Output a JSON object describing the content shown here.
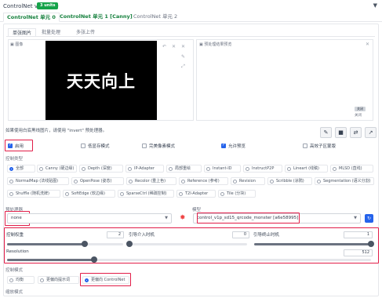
{
  "header": {
    "title": "ControlNet v1.1.449",
    "units_badge": "3 units"
  },
  "unit_tabs": [
    "ControlNet 单元 0",
    "ControlNet 单元 1 [Canny]",
    "ControlNet 单元 2"
  ],
  "image_tabs": [
    "单张图片",
    "批量处理",
    "多张上传"
  ],
  "image": {
    "label": "图像",
    "text": "天天向上"
  },
  "preview": {
    "label": "预处理结果预览",
    "close_btn": "关闭",
    "close_label": "关闭"
  },
  "hint": "如果使用白底黑线图片，请使用 \"invert\" 预处理器。",
  "options": {
    "enable": "启用",
    "low_vram": "低显存模式",
    "pixel_perfect": "完美像素模式",
    "allow_preview": "允许预览",
    "effective_region_mask": "高效子区蒙版"
  },
  "control_type": {
    "label": "控制类型",
    "items": [
      {
        "label": "全部",
        "selected": true
      },
      {
        "label": "Canny (硬边缘)",
        "selected": false
      },
      {
        "label": "Depth (深度)",
        "selected": false
      },
      {
        "label": "IP-Adapter",
        "selected": false
      },
      {
        "label": "局部重绘",
        "selected": false
      },
      {
        "label": "Instant-ID",
        "selected": false
      },
      {
        "label": "InstructP2P",
        "selected": false
      },
      {
        "label": "Lineart (线稿)",
        "selected": false
      },
      {
        "label": "MLSD (直线)",
        "selected": false
      },
      {
        "label": "NormalMap (法线贴图)",
        "selected": false
      },
      {
        "label": "OpenPose (姿态)",
        "selected": false
      },
      {
        "label": "Recolor (重上色)",
        "selected": false
      },
      {
        "label": "Reference (参考)",
        "selected": false
      },
      {
        "label": "Revision",
        "selected": false
      },
      {
        "label": "Scribble (涂鸦)",
        "selected": false
      },
      {
        "label": "Segmentation (语义分割)",
        "selected": false
      },
      {
        "label": "Shuffle (随机洗牌)",
        "selected": false
      },
      {
        "label": "SoftEdge (软边缘)",
        "selected": false
      },
      {
        "label": "SparseCtrl (稀疏控制)",
        "selected": false
      },
      {
        "label": "T2I-Adapter",
        "selected": false
      },
      {
        "label": "Tile (分块)",
        "selected": false
      }
    ]
  },
  "preprocessor": {
    "label": "预处理器",
    "value": "none"
  },
  "model": {
    "label": "模型",
    "value": "control_v1p_sd15_qrcode_monster [a6e58995]"
  },
  "weight": {
    "label": "控制权重",
    "value": "2",
    "fraction": 0.67
  },
  "start": {
    "label": "引导介入时机",
    "value": "0",
    "fraction": 0.0
  },
  "end": {
    "label": "引导终止时机",
    "value": "1",
    "fraction": 1.0
  },
  "resolution": {
    "label": "Resolution",
    "value": "512",
    "fraction": 0.24
  },
  "control_mode": {
    "label": "控制模式",
    "items": [
      {
        "label": "均衡",
        "selected": false
      },
      {
        "label": "更偏向提示词",
        "selected": false
      },
      {
        "label": "更偏向 ControlNet",
        "selected": true
      }
    ]
  },
  "resize_mode": {
    "label": "缩放模式"
  },
  "colors": {
    "accent": "#2563eb",
    "highlight": "#e11d48",
    "brand": "#16a34a"
  }
}
